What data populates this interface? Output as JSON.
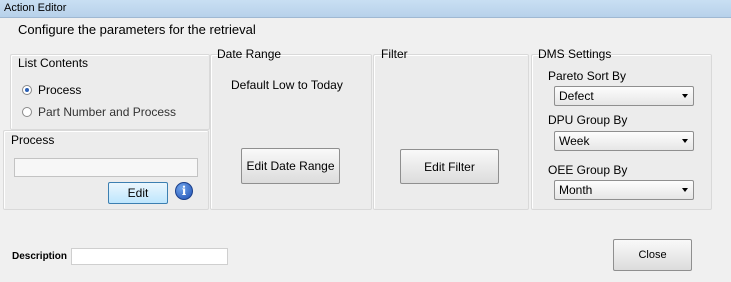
{
  "window": {
    "title": "Action Editor"
  },
  "header": {
    "subtitle": "Configure the parameters for the retrieval"
  },
  "list_contents": {
    "label": "List Contents",
    "options": [
      {
        "label": "Process",
        "checked": true
      },
      {
        "label": "Part Number and Process",
        "checked": false
      }
    ]
  },
  "process": {
    "label": "Process",
    "value": "",
    "edit_label": "Edit",
    "info_icon": "i"
  },
  "date_range": {
    "label": "Date Range",
    "value": "Default Low to Today",
    "button_label": "Edit Date Range"
  },
  "filter": {
    "label": "Filter",
    "button_label": "Edit Filter"
  },
  "dms": {
    "label": "DMS Settings",
    "pareto": {
      "label": "Pareto Sort By",
      "value": "Defect"
    },
    "dpu": {
      "label": "DPU Group By",
      "value": "Week"
    },
    "oee": {
      "label": "OEE Group By",
      "value": "Month"
    }
  },
  "footer": {
    "description_label": "Description",
    "description_value": "",
    "close_label": "Close"
  }
}
